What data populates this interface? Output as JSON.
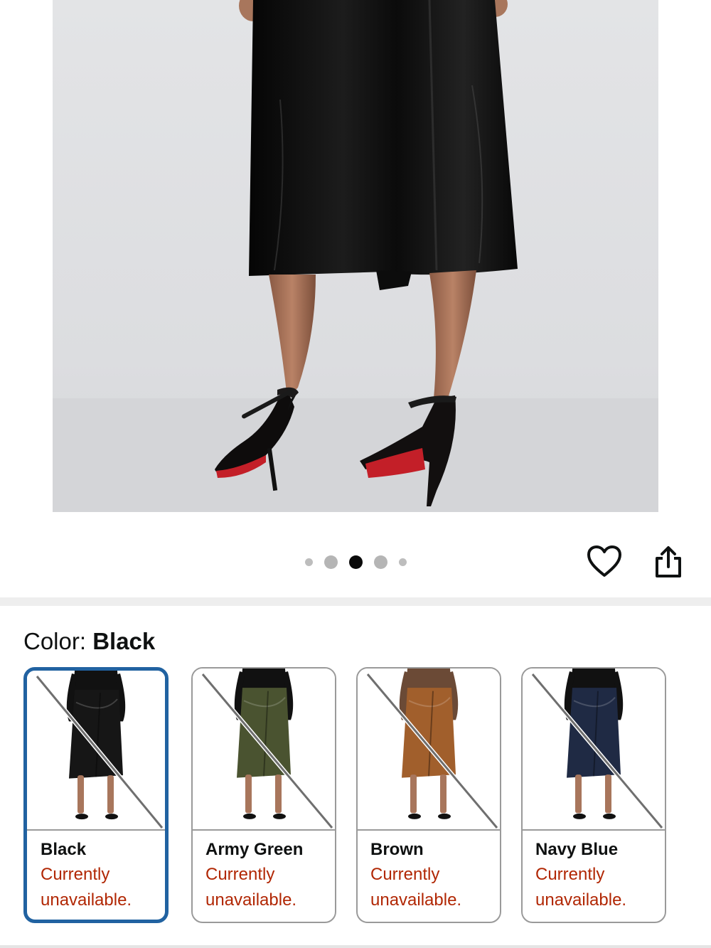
{
  "gallery": {
    "image_count": 5,
    "active_index": 2,
    "favorite_icon": "heart-icon",
    "share_icon": "share-icon"
  },
  "color_picker": {
    "label": "Color:",
    "selected": "Black",
    "options": [
      {
        "name": "Black",
        "status": "Currently unavailable.",
        "fabric": "#161616",
        "top": "#111111"
      },
      {
        "name": "Army Green",
        "status": "Currently unavailable.",
        "fabric": "#4a5330",
        "top": "#111111"
      },
      {
        "name": "Brown",
        "status": "Currently unavailable.",
        "fabric": "#a15f2c",
        "top": "#6b4a36"
      },
      {
        "name": "Navy Blue",
        "status": "Currently unavailable.",
        "fabric": "#1f2a44",
        "top": "#111111"
      }
    ]
  },
  "colors": {
    "selected_border": "#2162a1",
    "unavailable_text": "#b12704"
  }
}
